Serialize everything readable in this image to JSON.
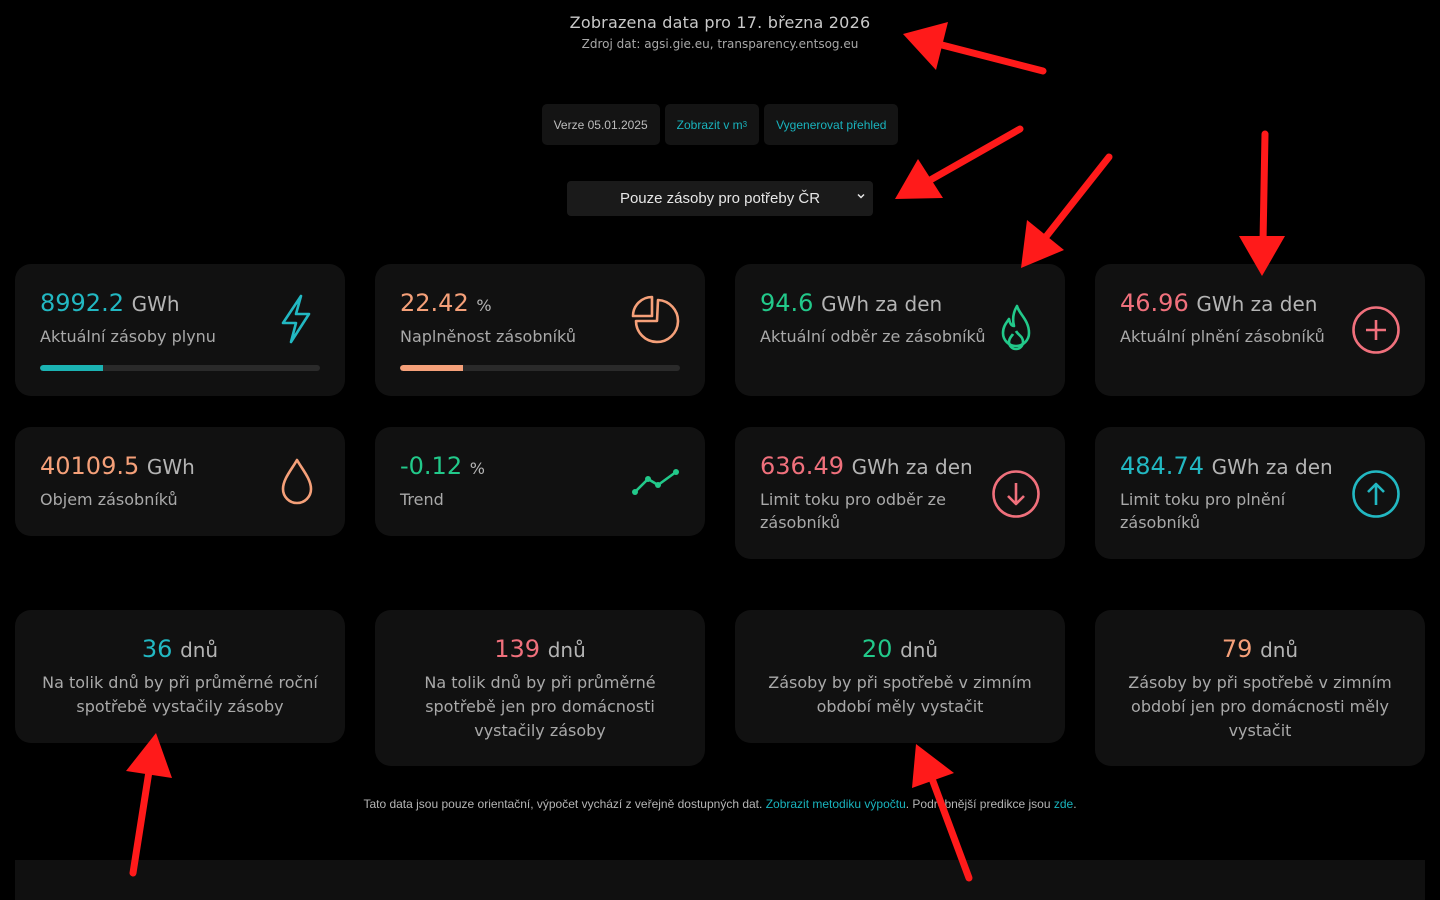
{
  "header": {
    "title": "Zobrazena data pro 17. března 2026",
    "source": "Zdroj dat: agsi.gie.eu, transparency.entsog.eu"
  },
  "toolbar": {
    "version_label": "Verze 05.01.2025",
    "m3_label": "Zobrazit v m",
    "m3_sup": "3",
    "generate_label": "Vygenerovat přehled"
  },
  "filter": {
    "selected": "Pouze zásoby pro potřeby ČR"
  },
  "stats": [
    {
      "value": "8992.2",
      "unit": "GWh",
      "label": "Aktuální zásoby plynu",
      "color": "#22b8c2",
      "icon": "lightning-icon",
      "progress": 0.224,
      "bar_color": "#1bb3b3"
    },
    {
      "value": "22.42",
      "unit": "%",
      "label": "Naplněnost zásobníků",
      "color": "#f5a079",
      "icon": "pie-chart-icon",
      "progress": 0.224,
      "bar_color": "#f5a079"
    },
    {
      "value": "94.6",
      "unit": "GWh za den",
      "label": "Aktuální odběr ze zásobníků",
      "color": "#22c98a",
      "icon": "flame-icon"
    },
    {
      "value": "46.96",
      "unit": "GWh za den",
      "label": "Aktuální plnění zásobníků",
      "color": "#f0707c",
      "icon": "plus-circle-icon"
    },
    {
      "value": "40109.5",
      "unit": "GWh",
      "label": "Objem zásobníků",
      "color": "#f5a079",
      "icon": "drop-icon"
    },
    {
      "value": "-0.12",
      "unit": "%",
      "label": "Trend",
      "color": "#22c98a",
      "icon": "trend-icon"
    },
    {
      "value": "636.49",
      "unit": "GWh za den",
      "label": "Limit toku pro odběr ze zásobníků",
      "color": "#f0707c",
      "icon": "arrow-down-circle-icon"
    },
    {
      "value": "484.74",
      "unit": "GWh za den",
      "label": "Limit toku pro plnění zásobníků",
      "color": "#22b8c2",
      "icon": "arrow-up-circle-icon"
    }
  ],
  "days": [
    {
      "value": "36",
      "unit": "dnů",
      "label": "Na tolik dnů by při průměrné roční spotřebě vystačily zásoby",
      "color": "#22b8c2"
    },
    {
      "value": "139",
      "unit": "dnů",
      "label": "Na tolik dnů by při průměrné spotřebě jen pro domácnosti vystačily zásoby",
      "color": "#f0707c"
    },
    {
      "value": "20",
      "unit": "dnů",
      "label": "Zásoby by při spotřebě v zimním období měly vystačit",
      "color": "#22c98a"
    },
    {
      "value": "79",
      "unit": "dnů",
      "label": "Zásoby by při spotřebě v zimním období jen pro domácnosti měly vystačit",
      "color": "#f5a079"
    }
  ],
  "footer": {
    "text1": "Tato data jsou pouze orientační, výpočet vychází z veřejně dostupných dat.",
    "link1": "Zobrazit metodiku výpočtu",
    "text2": ". Podrobnější predikce jsou",
    "link2": "zde",
    "text3": "."
  }
}
